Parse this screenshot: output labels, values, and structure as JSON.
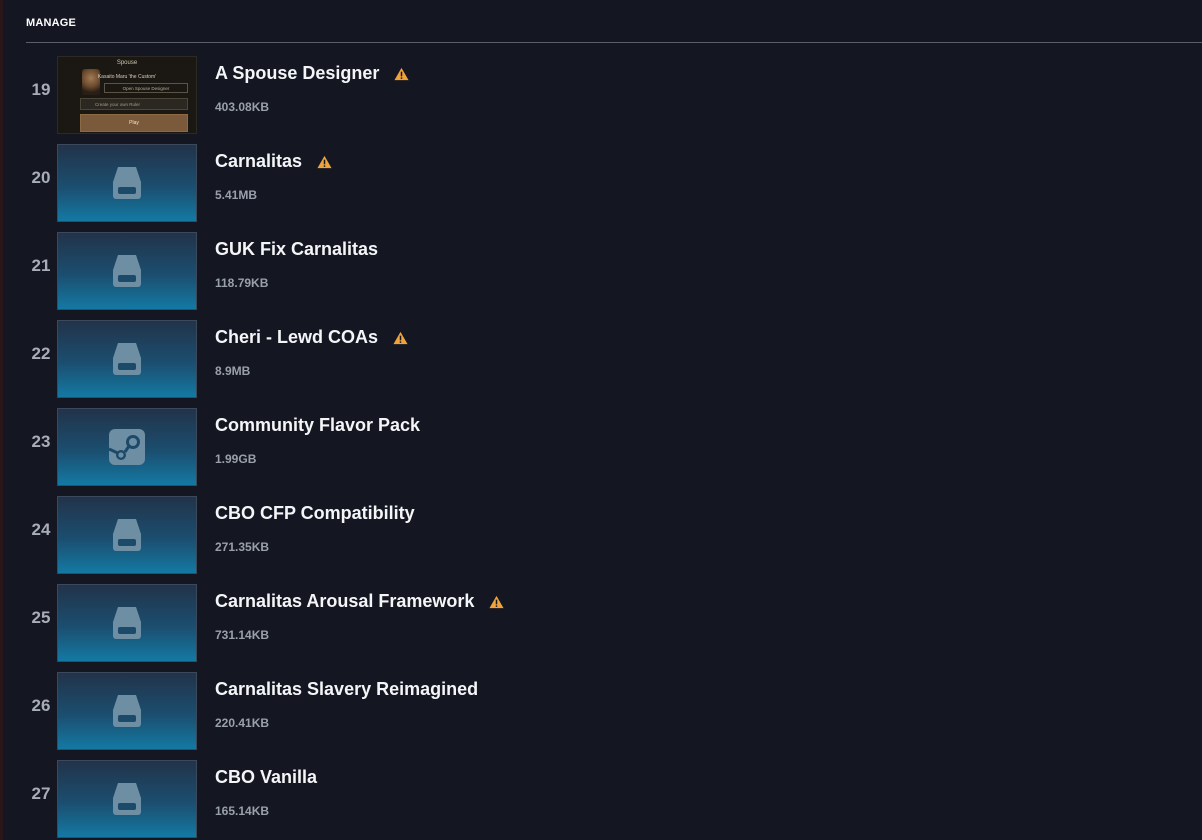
{
  "header": {
    "title": "MANAGE"
  },
  "shot": {
    "title": "Spouse",
    "subtitle": "Kasaito Maru 'the Custom'",
    "open_button": "Open Spouse Designer",
    "create_label": "Create your own Ruler",
    "play_label": "Play"
  },
  "colors": {
    "warning": "#f0a33b",
    "background": "#141722",
    "thumb_gradient_end": "#1479a3"
  },
  "mods": [
    {
      "index": "19",
      "name": "A Spouse Designer",
      "size": "403.08KB",
      "warning": true,
      "thumb": "screenshot"
    },
    {
      "index": "20",
      "name": "Carnalitas",
      "size": "5.41MB",
      "warning": true,
      "thumb": "drive-icon"
    },
    {
      "index": "21",
      "name": "GUK Fix Carnalitas",
      "size": "118.79KB",
      "warning": false,
      "thumb": "drive-icon"
    },
    {
      "index": "22",
      "name": "Cheri - Lewd COAs",
      "size": "8.9MB",
      "warning": true,
      "thumb": "drive-icon"
    },
    {
      "index": "23",
      "name": "Community Flavor Pack",
      "size": "1.99GB",
      "warning": false,
      "thumb": "steam-icon"
    },
    {
      "index": "24",
      "name": "CBO CFP Compatibility",
      "size": "271.35KB",
      "warning": false,
      "thumb": "drive-icon"
    },
    {
      "index": "25",
      "name": "Carnalitas Arousal Framework",
      "size": "731.14KB",
      "warning": true,
      "thumb": "drive-icon"
    },
    {
      "index": "26",
      "name": "Carnalitas Slavery Reimagined",
      "size": "220.41KB",
      "warning": false,
      "thumb": "drive-icon"
    },
    {
      "index": "27",
      "name": "CBO Vanilla",
      "size": "165.14KB",
      "warning": false,
      "thumb": "drive-icon"
    }
  ]
}
